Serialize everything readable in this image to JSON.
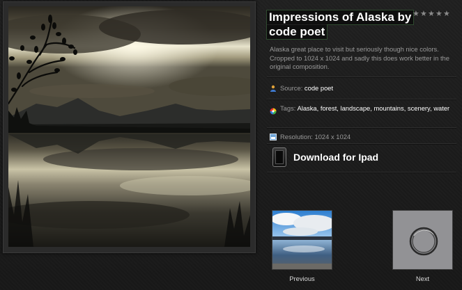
{
  "wallpaper": {
    "title": "Impressions of Alaska by code poet",
    "rating_stars": 5,
    "description": "Alaska great place to visit but seriously though nice colors. Cropped to 1024 x 1024 and sadly this does work better in the original composition.",
    "source_label": "Source:",
    "source_value": "code poet",
    "tags_label": "Tags:",
    "tags": "Alaska, forest, landscape, mountains, scenery, water",
    "resolution": "Resolution: 1024 x 1024"
  },
  "download": {
    "label": "Download for Ipad"
  },
  "nav": {
    "previous_label": "Previous",
    "next_label": "Next"
  },
  "colors": {
    "background": "#1c1c1c",
    "title_text": "#ffffff",
    "muted_text": "#9a9a9a"
  },
  "icons": {
    "star": "star-icon",
    "source": "user-icon",
    "tags": "color-wheel-icon",
    "resolution": "image-icon",
    "ipad": "ipad-icon"
  }
}
